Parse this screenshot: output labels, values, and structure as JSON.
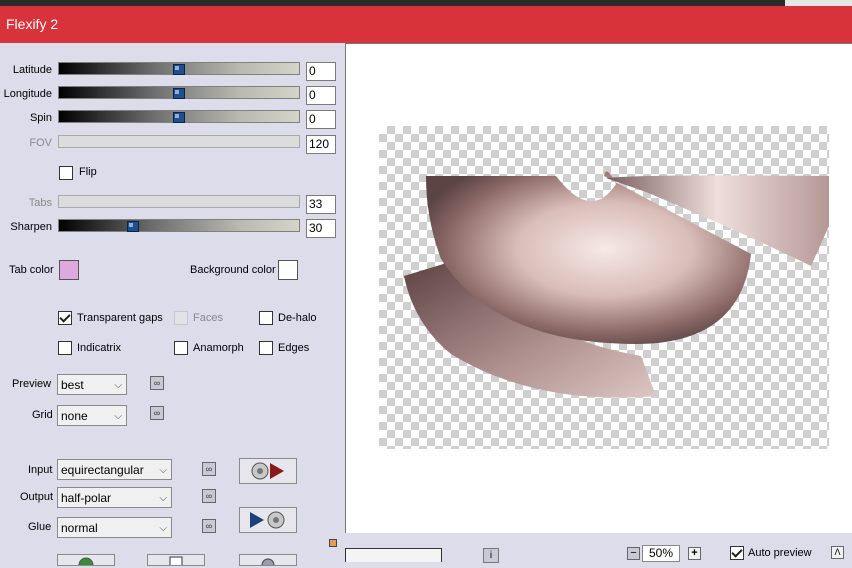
{
  "window": {
    "title": "Flexify 2"
  },
  "sliders": [
    {
      "label": "Latitude",
      "value": "0",
      "position": 0.5,
      "enabled": true
    },
    {
      "label": "Longitude",
      "value": "0",
      "position": 0.5,
      "enabled": true
    },
    {
      "label": "Spin",
      "value": "0",
      "position": 0.5,
      "enabled": true
    },
    {
      "label": "FOV",
      "value": "120",
      "position": 1.0,
      "enabled": false
    },
    {
      "label": "Tabs",
      "value": "33",
      "position": 0.0,
      "enabled": false
    },
    {
      "label": "Sharpen",
      "value": "30",
      "position": 0.31,
      "enabled": true
    }
  ],
  "flip": {
    "label": "Flip",
    "checked": false
  },
  "colors": {
    "tab_label": "Tab color",
    "tab_value": "#dfa9dd",
    "background_label": "Background color",
    "background_value": "#ffffff"
  },
  "options": {
    "transparent_gaps": {
      "label": "Transparent gaps",
      "checked": true
    },
    "faces": {
      "label": "Faces",
      "checked": false
    },
    "de_halo": {
      "label": "De-halo",
      "checked": false
    },
    "indicatrix": {
      "label": "Indicatrix",
      "checked": false
    },
    "anamorph": {
      "label": "Anamorph",
      "checked": false
    },
    "edges": {
      "label": "Edges",
      "checked": false
    }
  },
  "preview_select": {
    "label": "Preview",
    "value": "best"
  },
  "grid_select": {
    "label": "Grid",
    "value": "none"
  },
  "input_select": {
    "label": "Input",
    "value": "equirectangular"
  },
  "output_select": {
    "label": "Output",
    "value": "half-polar"
  },
  "glue_select": {
    "label": "Glue",
    "value": "normal"
  },
  "status": {
    "zoom": "50%",
    "auto_preview_label": "Auto preview",
    "auto_preview_checked": true
  },
  "accent": "#d8323a"
}
